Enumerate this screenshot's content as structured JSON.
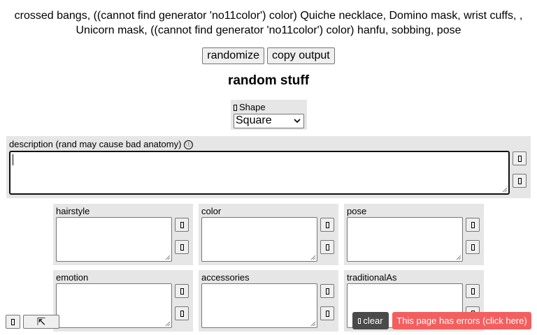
{
  "output_text": "crossed bangs, ((cannot find generator 'no11color') color) Quiche necklace, Domino mask, wrist cuffs, , Unicorn mask, ((cannot find generator 'no11color') color) hanfu, sobbing, pose",
  "buttons": {
    "randomize": "randomize",
    "copy_output": "copy output"
  },
  "heading": "random stuff",
  "shape": {
    "label": "Shape",
    "selected": "Square",
    "icon": "box-glyph-icon"
  },
  "description": {
    "label": "description (rand may cause bad anatomy)",
    "info_icon": "ⓘ",
    "value": ""
  },
  "fields": [
    {
      "label": "hairstyle",
      "value": ""
    },
    {
      "label": "color",
      "value": ""
    },
    {
      "label": "pose",
      "value": ""
    },
    {
      "label": "emotion",
      "value": ""
    },
    {
      "label": "accessories",
      "value": ""
    },
    {
      "label": "traditionalAs",
      "value": ""
    }
  ],
  "bottom": {
    "expand_icon": "⇱",
    "clear_label": "clear",
    "error_label": "This page has errors (click here)",
    "error_color": "#f35f5f",
    "clear_color": "#4a4a4a"
  }
}
